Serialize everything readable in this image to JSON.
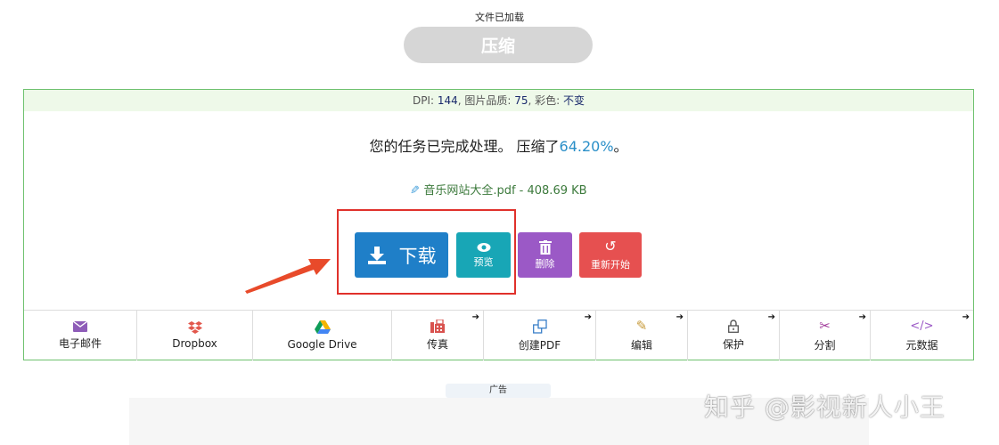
{
  "header": {
    "status": "文件已加载",
    "compress_label": "压缩"
  },
  "settings": {
    "dpi_label": "DPI: ",
    "dpi_value": "144",
    "quality_label": ", 图片品质: ",
    "quality_value": "75",
    "color_label": ", 彩色: ",
    "color_value": "不变"
  },
  "result": {
    "message": "您的任务已完成处理。 压缩了",
    "percent": "64.20%",
    "end": "。"
  },
  "file": {
    "name_size": "音乐网站大全.pdf - 408.69 KB"
  },
  "actions": {
    "download": "下载",
    "preview": "预览",
    "delete": "删除",
    "restart": "重新开始"
  },
  "tools": [
    {
      "label": "电子邮件",
      "icon": "email-icon",
      "color": "#8e5cb8"
    },
    {
      "label": "Dropbox",
      "icon": "dropbox-icon",
      "color": "#e2574c"
    },
    {
      "label": "Google Drive",
      "icon": "google-drive-icon",
      "color": "#3a8a3a"
    },
    {
      "label": "传真",
      "icon": "fax-icon",
      "color": "#d9534f"
    },
    {
      "label": "创建PDF",
      "icon": "create-pdf-icon",
      "color": "#3a7fc8"
    },
    {
      "label": "编辑",
      "icon": "pencil-icon",
      "color": "#c79a3a"
    },
    {
      "label": "保护",
      "icon": "lock-icon",
      "color": "#555555"
    },
    {
      "label": "分割",
      "icon": "scissors-icon",
      "color": "#a13a9a"
    },
    {
      "label": "元数据",
      "icon": "code-icon",
      "color": "#9b59c6"
    }
  ],
  "ad": {
    "label": "广告"
  },
  "watermark": "知乎 @影视新人小王",
  "colors": {
    "download": "#1f7fc8",
    "preview": "#18a6b6",
    "delete": "#9b59c6",
    "restart": "#e65050",
    "panel_border": "#6fc26f",
    "highlight": "#e0312b"
  }
}
